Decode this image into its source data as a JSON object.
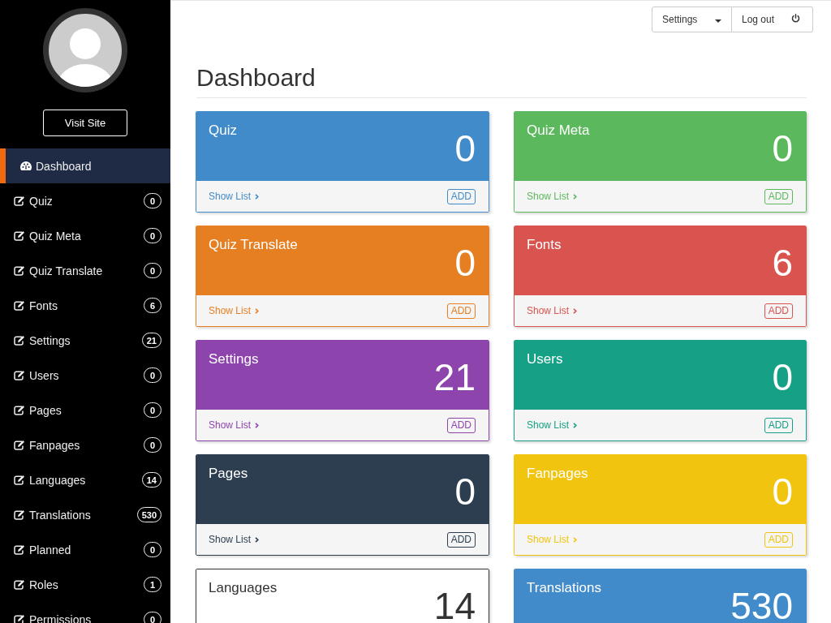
{
  "sidebar": {
    "visit_site": "Visit Site",
    "items": [
      {
        "kind": "dashboard",
        "label": "Dashboard",
        "selected": true
      },
      {
        "kind": "section",
        "label": "Quiz",
        "badge": "0",
        "selected": false
      },
      {
        "kind": "section",
        "label": "Quiz Meta",
        "badge": "0",
        "selected": false
      },
      {
        "kind": "section",
        "label": "Quiz Translate",
        "badge": "0",
        "selected": false
      },
      {
        "kind": "section",
        "label": "Fonts",
        "badge": "6",
        "selected": false
      },
      {
        "kind": "section",
        "label": "Settings",
        "badge": "21",
        "selected": false
      },
      {
        "kind": "section",
        "label": "Users",
        "badge": "0",
        "selected": false
      },
      {
        "kind": "section",
        "label": "Pages",
        "badge": "0",
        "selected": false
      },
      {
        "kind": "section",
        "label": "Fanpages",
        "badge": "0",
        "selected": false
      },
      {
        "kind": "section",
        "label": "Languages",
        "badge": "14",
        "selected": false
      },
      {
        "kind": "section",
        "label": "Translations",
        "badge": "530",
        "selected": false
      },
      {
        "kind": "section",
        "label": "Planned",
        "badge": "0",
        "selected": false
      },
      {
        "kind": "section",
        "label": "Roles",
        "badge": "1",
        "selected": false
      },
      {
        "kind": "section",
        "label": "Permissions",
        "badge": "0",
        "selected": false
      }
    ]
  },
  "topbar": {
    "settings": "Settings",
    "logout": "Log out"
  },
  "page_title": "Dashboard",
  "cards": [
    {
      "kind": "filled",
      "title": "Quiz",
      "count": "0",
      "color": "#428bca",
      "link": "Show List",
      "add": "ADD"
    },
    {
      "kind": "filled",
      "title": "Quiz Meta",
      "count": "0",
      "color": "#5cb85c",
      "link": "Show List",
      "add": "ADD"
    },
    {
      "kind": "filled",
      "title": "Quiz Translate",
      "count": "0",
      "color": "#e67e22",
      "link": "Show List",
      "add": "ADD"
    },
    {
      "kind": "filled",
      "title": "Fonts",
      "count": "6",
      "color": "#d9534f",
      "link": "Show List",
      "add": "ADD"
    },
    {
      "kind": "filled",
      "title": "Settings",
      "count": "21",
      "color": "#8e44ad",
      "link": "Show List",
      "add": "ADD"
    },
    {
      "kind": "filled",
      "title": "Users",
      "count": "0",
      "color": "#16a085",
      "link": "Show List",
      "add": "ADD"
    },
    {
      "kind": "filled",
      "title": "Pages",
      "count": "0",
      "color": "#2c3e50",
      "link": "Show List",
      "add": "ADD"
    },
    {
      "kind": "filled",
      "title": "Fanpages",
      "count": "0",
      "color": "#f1c40f",
      "link": "Show List",
      "add": "ADD"
    },
    {
      "kind": "outline",
      "title": "Languages",
      "count": "14",
      "color": "#333333"
    },
    {
      "kind": "filled",
      "title": "Translations",
      "count": "530",
      "color": "#428bca"
    }
  ]
}
